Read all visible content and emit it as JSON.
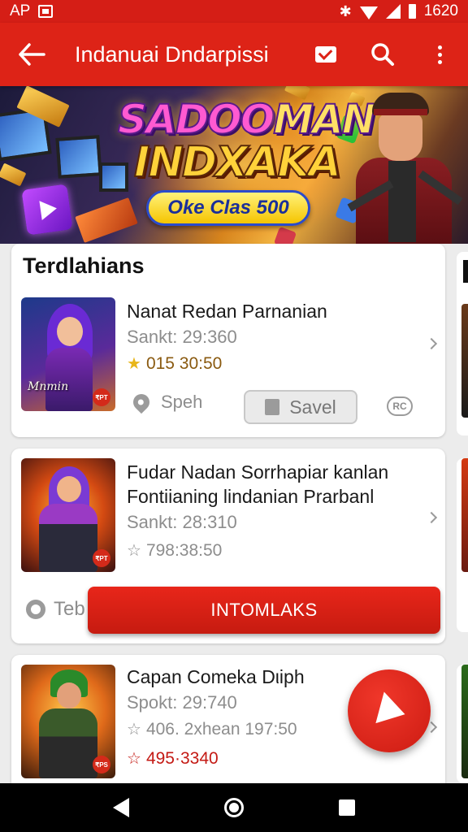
{
  "status_bar": {
    "left_text": "AP",
    "time": "1620"
  },
  "app_bar": {
    "title": "Indanuai Dndarpissi"
  },
  "banner": {
    "title_line1_a": "SADOO",
    "title_line1_b": "MAN",
    "title_line2": "INDXAKA",
    "pill_text": "Oke Clas 500"
  },
  "section": {
    "title": "Terdlahians"
  },
  "items": [
    {
      "name": "Nanat Redan Parnanian",
      "meta": "Sankt: 29:360",
      "rating": "015 30:50",
      "thumb_caption": "Mnmin",
      "thumb_badge": "₹PT",
      "location": "Speh",
      "save_label": "Savel",
      "extra_badge": "RC"
    },
    {
      "name_line1": "Fudar Nadan Sorrhapiar kanlan",
      "name_line2": "Fontiianing lindanian Prarbanl",
      "meta": "Sankt: 28:310",
      "rating": "798:38:50",
      "thumb_badge": "₹PT",
      "partial_label": "Teb",
      "cta_label": "INTOMLAKS"
    },
    {
      "name": "Capan Comeka Dιiph",
      "meta": "Spokt: 29:740",
      "rating1": "406. 2xhean 197:50",
      "rating2": "495·3340",
      "thumb_badge": "₹PS"
    }
  ],
  "colors": {
    "primary": "#dd2317",
    "status_bar": "#d51e16",
    "background": "#ececec"
  }
}
